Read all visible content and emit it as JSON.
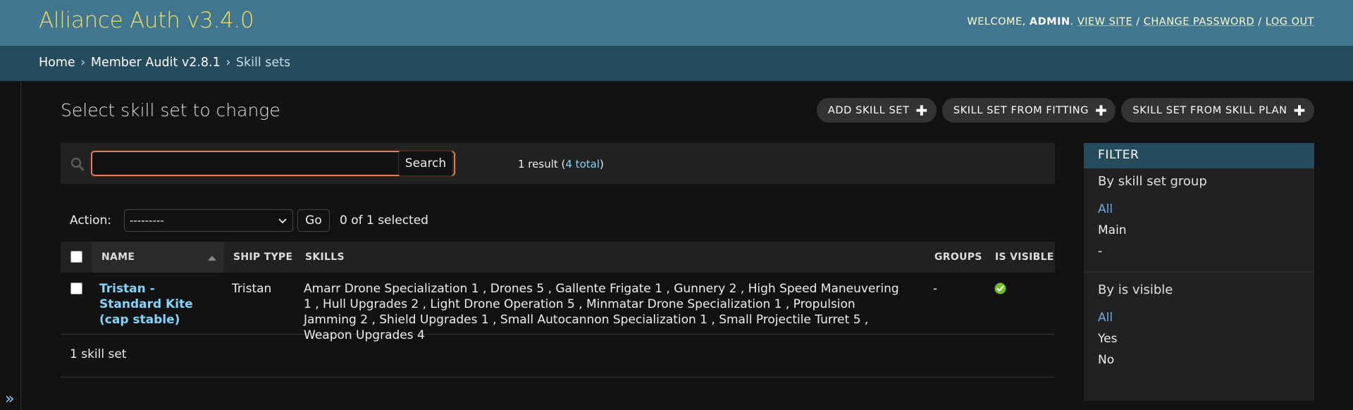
{
  "header": {
    "branding": "Alliance Auth v3.4.0",
    "welcome": "Welcome,",
    "username": "admin",
    "view_site": "View site",
    "change_password": "Change password",
    "log_out": "Log out"
  },
  "breadcrumbs": {
    "home": "Home",
    "app": "Member Audit v2.8.1",
    "current": "Skill sets",
    "separator": "›"
  },
  "nav_toggle": "»",
  "page_title": "Select skill set to change",
  "object_tools": {
    "add": "Add skill set",
    "from_fitting": "Skill set from fitting",
    "from_plan": "Skill set from skill plan"
  },
  "search": {
    "value": "",
    "placeholder": "",
    "button": "Search",
    "result_prefix": "1 result (",
    "total_link": "4 total",
    "result_suffix": ")"
  },
  "actions": {
    "label": "Action:",
    "selected_option": "---------",
    "go": "Go",
    "selected_count": "0 of 1 selected"
  },
  "table": {
    "headers": {
      "name": "Name",
      "ship_type": "Ship type",
      "skills": "Skills",
      "groups": "Groups",
      "is_visible": "Is visible"
    },
    "rows": [
      {
        "name": "Tristan - Standard Kite (cap stable)",
        "ship_type": "Tristan",
        "skills": "Amarr Drone Specialization 1 , Drones 5 , Gallente Frigate 1 , Gunnery 2 , High Speed Maneuvering 1 , Hull Upgrades 2 , Light Drone Operation 5 , Minmatar Drone Specialization 1 , Propulsion Jamming 2 , Shield Upgrades 1 , Small Autocannon Specialization 1 , Small Projectile Turret 5 , Weapon Upgrades 4",
        "groups": "-",
        "is_visible": true
      }
    ],
    "paginator": "1 skill set"
  },
  "filter": {
    "title": "Filter",
    "sections": [
      {
        "title": "By skill set group",
        "options": [
          "All",
          "Main",
          "-"
        ],
        "selected": "All"
      },
      {
        "title": "By is visible",
        "options": [
          "All",
          "Yes",
          "No"
        ],
        "selected": "All"
      }
    ]
  },
  "colors": {
    "header_bg": "#417690",
    "breadcrumbs_bg": "#264b5d",
    "branding": "#f5dd5d",
    "link": "#81d4fa",
    "visible_true": "#70bf2b",
    "search_focus": "#e07c62"
  }
}
